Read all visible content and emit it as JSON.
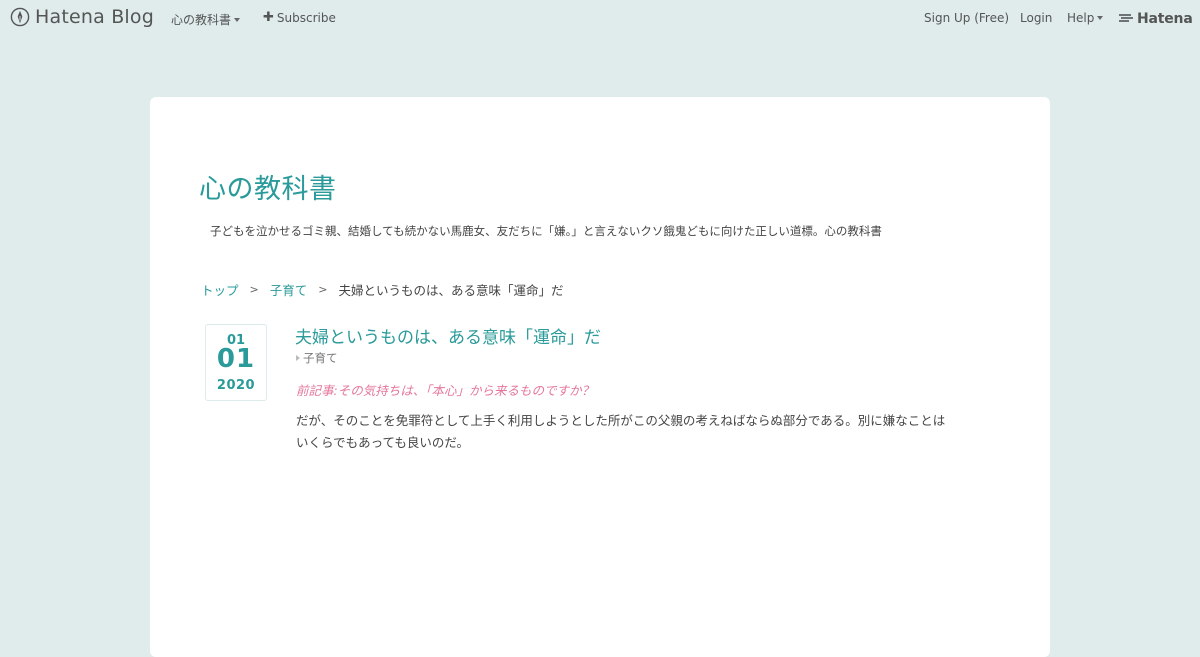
{
  "topbar": {
    "brand": "Hatena Blog",
    "blog_menu": "心の教科書",
    "subscribe": "Subscribe",
    "signup": "Sign Up (Free)",
    "login": "Login",
    "help": "Help",
    "hatena": "Hatena"
  },
  "blog": {
    "title": "心の教科書",
    "description": "子どもを泣かせるゴミ親、結婚しても続かない馬鹿女、友だちに「嫌。」と言えないクソ餓鬼どもに向けた正しい道標。心の教科書"
  },
  "breadcrumb": {
    "top": "トップ",
    "separator": ">",
    "category": "子育て",
    "current": "夫婦というものは、ある意味「運命」だ"
  },
  "entry": {
    "date": {
      "month": "01",
      "day": "01",
      "year": "2020"
    },
    "title": "夫婦というものは、ある意味「運命」だ",
    "category": "子育て",
    "prev_article": "前記事:その気持ちは、「本心」から来るものですか？",
    "body": "だが、そのことを免罪符として上手く利用しようとした所がこの父親の考えねばならぬ部分である。別に嫌なことはいくらでもあっても良いのだ。"
  },
  "colors": {
    "background": "#dfeceb",
    "accent": "#2a9a9a",
    "prev_link": "#e5789a"
  }
}
